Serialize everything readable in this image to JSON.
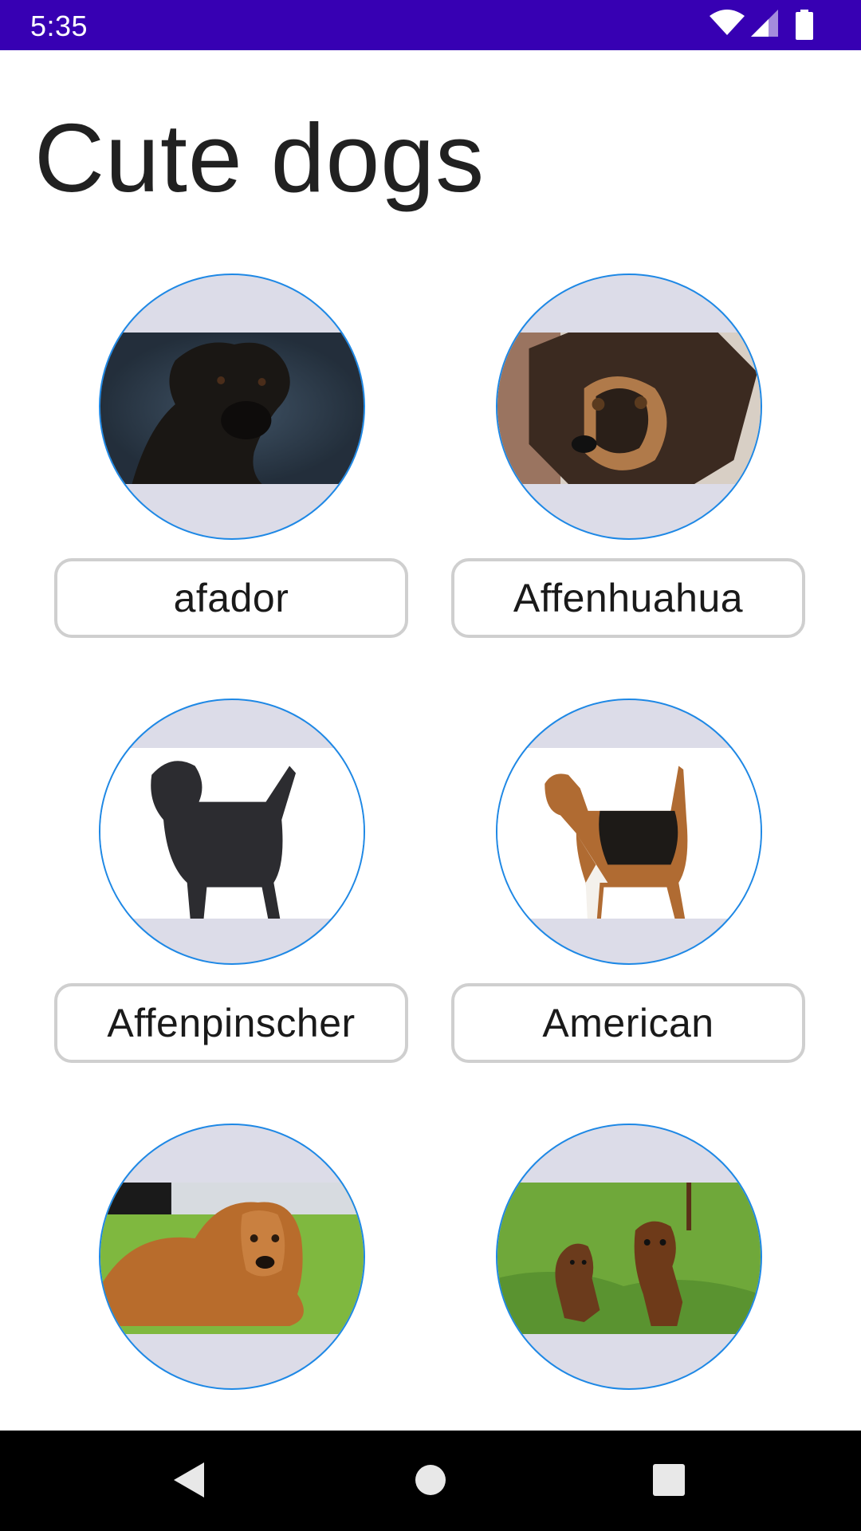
{
  "status_bar": {
    "time": "5:35",
    "icons": [
      "wifi-icon",
      "signal-icon",
      "battery-icon"
    ]
  },
  "page": {
    "title": "Cute dogs"
  },
  "dogs": [
    {
      "label": "afador",
      "photo": "black labrador mix on dark blue backdrop"
    },
    {
      "label": "Affenhuahua",
      "photo": "long-haired black and tan chihuahua"
    },
    {
      "label": "Affenpinscher",
      "photo": "black affenpinscher standing on white"
    },
    {
      "label": "American",
      "photo": "tricolor foxhound standing on white"
    },
    {
      "label": "",
      "photo": "golden retriever lying on grass"
    },
    {
      "label": "",
      "photo": "two dachshunds on grass"
    }
  ],
  "navigation": {
    "buttons": [
      "back-icon",
      "home-icon",
      "recents-icon"
    ]
  },
  "colors": {
    "status_bar": "#3700B3",
    "avatar_border": "#1E88E5",
    "avatar_bg": "#dcdce8"
  }
}
